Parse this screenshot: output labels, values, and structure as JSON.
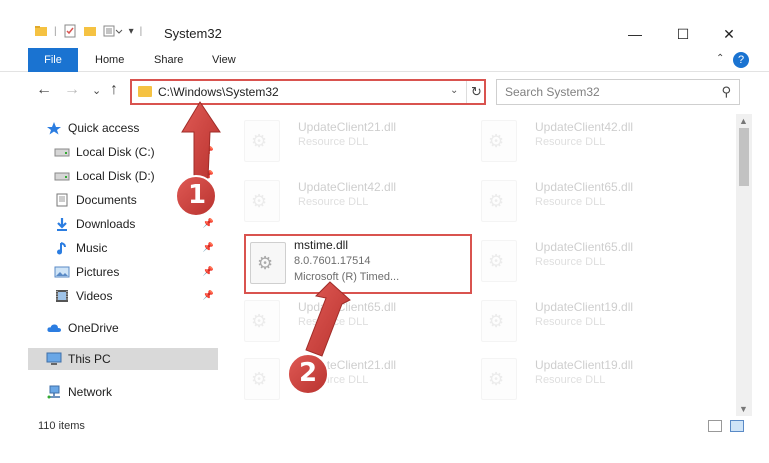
{
  "window": {
    "title": "System32",
    "minimize_glyph": "—",
    "maximize_glyph": "☐",
    "close_glyph": "✕"
  },
  "ribbon": {
    "tabs": [
      "File",
      "Home",
      "Share",
      "View"
    ],
    "help_glyph": "?",
    "collapse_glyph": "⌃"
  },
  "nav": {
    "back_glyph": "←",
    "forward_glyph": "→",
    "recent_glyph": "⌄",
    "up_glyph": "↑"
  },
  "address": {
    "path": "C:\\Windows\\System32",
    "dropdown_glyph": "⌄",
    "refresh_glyph": "↻"
  },
  "search": {
    "placeholder": "Search System32",
    "icon_glyph": "⚲"
  },
  "sidebar": {
    "items": [
      {
        "label": "Quick access",
        "icon": "star-icon",
        "pinned": false
      },
      {
        "label": "Local Disk (C:)",
        "icon": "drive-icon",
        "pinned": true
      },
      {
        "label": "Local Disk (D:)",
        "icon": "drive-icon",
        "pinned": true
      },
      {
        "label": "Documents",
        "icon": "documents-icon",
        "pinned": true
      },
      {
        "label": "Downloads",
        "icon": "download-icon",
        "pinned": true
      },
      {
        "label": "Music",
        "icon": "music-icon",
        "pinned": true
      },
      {
        "label": "Pictures",
        "icon": "pictures-icon",
        "pinned": true
      },
      {
        "label": "Videos",
        "icon": "videos-icon",
        "pinned": true
      },
      {
        "label": "OneDrive",
        "icon": "cloud-icon",
        "pinned": false
      },
      {
        "label": "This PC",
        "icon": "computer-icon",
        "pinned": false,
        "selected": true
      },
      {
        "label": "Network",
        "icon": "network-icon",
        "pinned": false
      }
    ]
  },
  "files": {
    "left": [
      {
        "name": "UpdateClient21.dll",
        "type": "Resource DLL",
        "faded": true
      },
      {
        "name": "UpdateClient42.dll",
        "type": "Resource DLL",
        "faded": true
      },
      {
        "name": "mstime.dll",
        "type": "8.0.7601.17514",
        "desc": "Microsoft (R) Timed...",
        "faded": false
      },
      {
        "name": "UpdateClient65.dll",
        "type": "Resource DLL",
        "faded": true
      },
      {
        "name": "UpdateClient21.dll",
        "type": "Resource DLL",
        "faded": true
      }
    ],
    "right": [
      {
        "name": "UpdateClient42.dll",
        "type": "Resource DLL",
        "faded": true
      },
      {
        "name": "UpdateClient65.dll",
        "type": "Resource DLL",
        "faded": true
      },
      {
        "name": "UpdateClient65.dll",
        "type": "Resource DLL",
        "faded": true
      },
      {
        "name": "UpdateClient19.dll",
        "type": "Resource DLL",
        "faded": true
      },
      {
        "name": "UpdateClient19.dll",
        "type": "Resource DLL",
        "faded": true
      }
    ]
  },
  "status": {
    "item_count": "110 items"
  },
  "callouts": [
    "1",
    "2"
  ],
  "colors": {
    "accent": "#1a73d1",
    "highlight": "#d9534f",
    "folder": "#f5c242"
  }
}
